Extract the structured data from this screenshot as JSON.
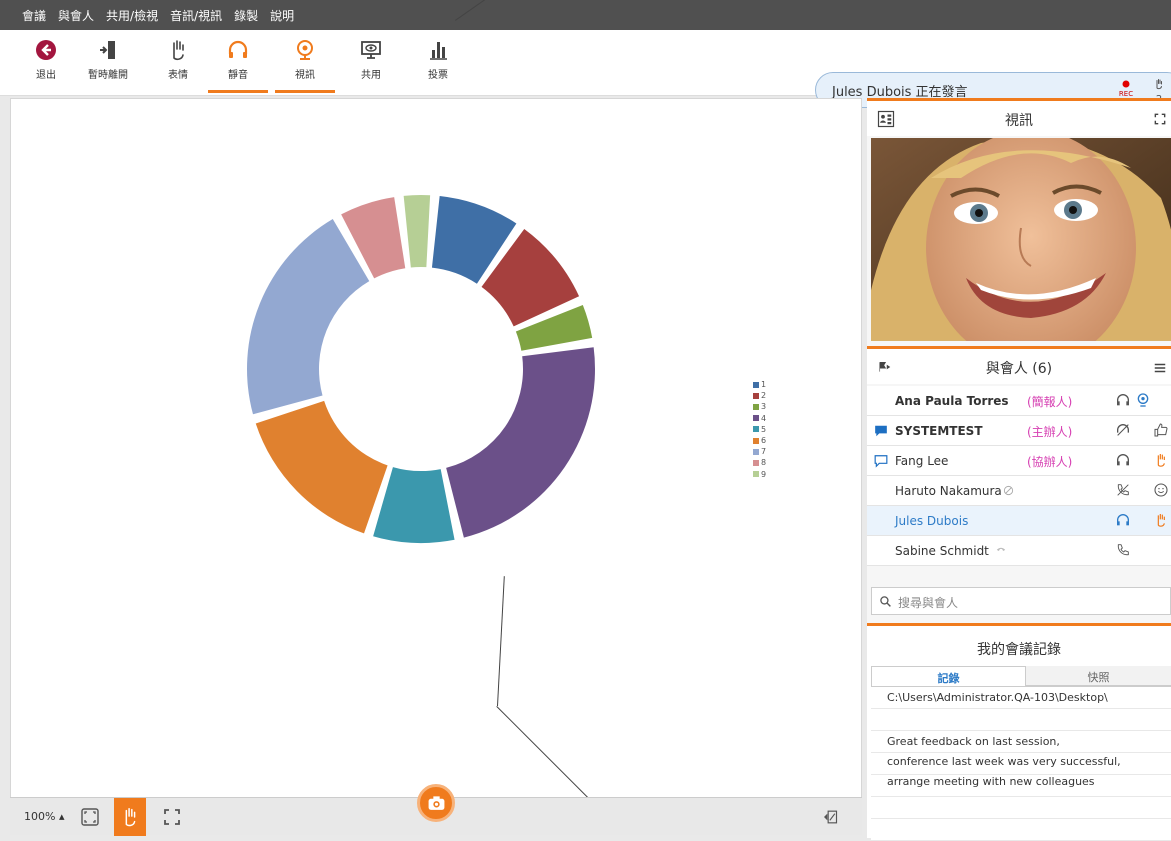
{
  "menu": [
    "會議",
    "與會人",
    "共用/檢視",
    "音訊/視訊",
    "錄製",
    "說明"
  ],
  "toolbar": [
    {
      "label": "退出",
      "icon": "exit-icon",
      "active": false
    },
    {
      "label": "暫時離開",
      "icon": "step-away-icon",
      "active": false
    },
    {
      "label": "表情",
      "icon": "hand-icon",
      "active": false
    },
    {
      "label": "靜音",
      "icon": "headset-icon",
      "active": true
    },
    {
      "label": "視訊",
      "icon": "webcam-icon",
      "active": true
    },
    {
      "label": "共用",
      "icon": "share-screen-icon",
      "active": false
    },
    {
      "label": "投票",
      "icon": "poll-icon",
      "active": false
    }
  ],
  "speaker": {
    "text": "Jules Dubois 正在發言"
  },
  "rec": {
    "label": "REC"
  },
  "raised_hands": {
    "count": "2"
  },
  "stage": {
    "zoom": "100%",
    "accent": "#f07b1d"
  },
  "chart_data": {
    "type": "pie",
    "donut": true,
    "categories": [
      "1",
      "2",
      "3",
      "4",
      "5",
      "6",
      "7",
      "8",
      "9"
    ],
    "values": [
      8.4,
      8.9,
      4.0,
      23.9,
      8.4,
      15.5,
      21.6,
      6.0,
      3.3
    ],
    "colors": [
      "#3f6fa6",
      "#a6403e",
      "#7fa342",
      "#6b5089",
      "#3b98ad",
      "#e0812f",
      "#93a8d1",
      "#d68f91",
      "#b6cf95"
    ],
    "legend": [
      "1",
      "2",
      "3",
      "4",
      "5",
      "6",
      "7",
      "8",
      "9"
    ],
    "legend_position": "right"
  },
  "video_panel": {
    "title": "視訊"
  },
  "participants": {
    "title": "與會人 (6)",
    "rows": [
      {
        "name": "Ana Paula Torres",
        "role": "(簡報人)"
      },
      {
        "name": "SYSTEMTEST",
        "role": "(主辦人)"
      },
      {
        "name": "Fang Lee",
        "role": "(協辦人)"
      },
      {
        "name": "Haruto Nakamura",
        "role": ""
      },
      {
        "name": "Jules Dubois",
        "role": ""
      },
      {
        "name": "Sabine Schmidt",
        "role": ""
      }
    ],
    "search_placeholder": "搜尋與會人"
  },
  "notes": {
    "title": "我的會議記錄",
    "tabs": [
      "記錄",
      "快照"
    ],
    "path": "C:\\Users\\Administrator.QA-103\\Desktop\\",
    "lines": [
      "Great feedback on last session,",
      "conference last week was very successful,",
      "arrange meeting with new colleagues"
    ]
  }
}
